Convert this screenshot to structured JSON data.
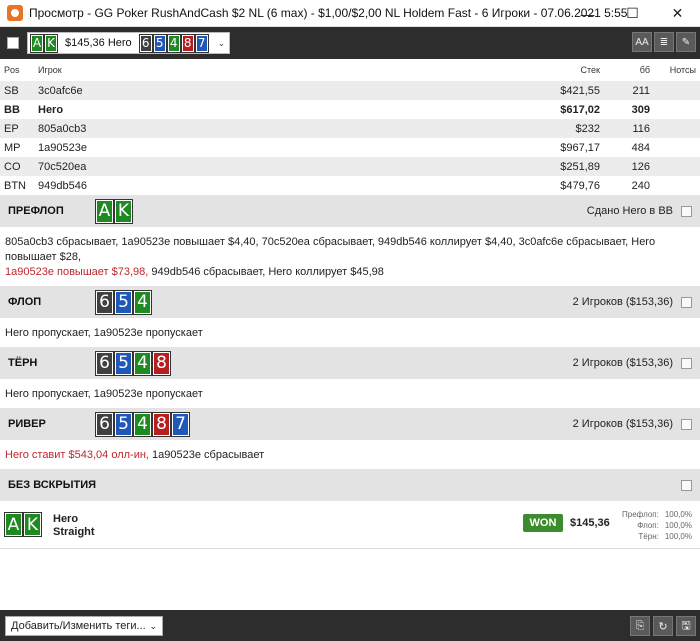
{
  "window": {
    "title": "Просмотр - GG Poker RushAndCash $2 NL (6 max) - $1,00/$2,00 NL Holdem Fast - 6 Игроки - 07.06.2021 5:55",
    "minimize": "—",
    "maximize": "☐",
    "close": "✕"
  },
  "toolbar": {
    "hero_cards": [
      {
        "rank": "A",
        "suit": "c"
      },
      {
        "rank": "K",
        "suit": "c"
      }
    ],
    "amount": "$145,36 Hero",
    "board": [
      {
        "rank": "6",
        "suit": "s"
      },
      {
        "rank": "5",
        "suit": "d"
      },
      {
        "rank": "4",
        "suit": "c"
      },
      {
        "rank": "8",
        "suit": "h"
      },
      {
        "rank": "7",
        "suit": "d"
      }
    ],
    "chevron": "⌄",
    "btn_font": "AA",
    "btn_list": "≣",
    "btn_edit": "✎"
  },
  "players": {
    "headers": {
      "pos": "Pos",
      "player": "Игрок",
      "stack": "Стек",
      "bb": "бб",
      "notes": "Нотсы"
    },
    "rows": [
      {
        "pos": "SB",
        "player": "3c0afc6e",
        "stack": "$421,55",
        "bb": "211"
      },
      {
        "pos": "BB",
        "player": "Hero",
        "stack": "$617,02",
        "bb": "309"
      },
      {
        "pos": "EP",
        "player": "805a0cb3",
        "stack": "$232",
        "bb": "116"
      },
      {
        "pos": "MP",
        "player": "1a90523e",
        "stack": "$967,17",
        "bb": "484"
      },
      {
        "pos": "CO",
        "player": "70c520ea",
        "stack": "$251,89",
        "bb": "126"
      },
      {
        "pos": "BTN",
        "player": "949db546",
        "stack": "$479,76",
        "bb": "240"
      }
    ]
  },
  "preflop": {
    "name": "ПРЕФЛОП",
    "right": "Сдано Hero в BB",
    "line1": "805a0cb3 сбрасывает, 1a90523e повышает $4,40, 70c520ea сбрасывает, 949db546 коллирует $4,40, 3c0afc6e сбрасывает, Hero повышает $28,",
    "line2_red": "1a90523e повышает $73,98,",
    "line2_rest": " 949db546 сбрасывает, Hero коллирует $45,98"
  },
  "flop": {
    "name": "ФЛОП",
    "right": "2 Игроков ($153,36)",
    "actions": "Hero пропускает, 1a90523e пропускает"
  },
  "turn": {
    "name": "ТЁРН",
    "right": "2 Игроков ($153,36)",
    "actions": "Hero пропускает, 1a90523e пропускает"
  },
  "river": {
    "name": "РИВЕР",
    "right": "2 Игроков ($153,36)",
    "actions_red": "Hero ставит $543,04 олл-ин,",
    "actions_rest": " 1a90523e сбрасывает"
  },
  "showdown": {
    "name": "БЕЗ ВСКРЫТИЯ"
  },
  "summary": {
    "player": "Hero",
    "hand": "Straight",
    "badge": "WON",
    "amount": "$145,36",
    "equity": [
      {
        "label": "Префлоп:",
        "value": "100,0%"
      },
      {
        "label": "Флоп:",
        "value": "100,0%"
      },
      {
        "label": "Тёрн:",
        "value": "100,0%"
      }
    ]
  },
  "bottom": {
    "tags_placeholder": "Добавить/Изменить теги...",
    "chevron": "⌄",
    "btn_copy": "⎘",
    "btn_refresh": "↻",
    "btn_save": "🖫"
  },
  "colors": {
    "clubs": "#1f8a22",
    "spades": "#404040",
    "hearts": "#b51f1f",
    "diamonds": "#1f58b8",
    "won": "#3c8b2c",
    "action_red": "#c0262d"
  }
}
